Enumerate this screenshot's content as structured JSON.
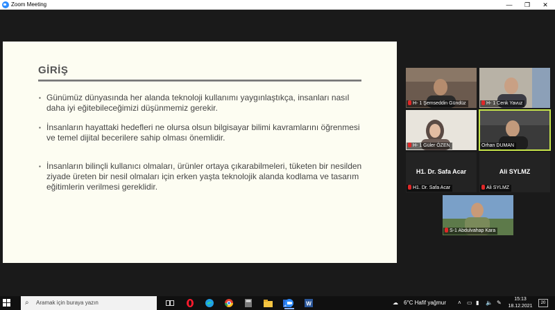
{
  "window": {
    "title": "Zoom Meeting",
    "controls": {
      "minimize": "—",
      "maximize": "❐",
      "close": "✕"
    }
  },
  "slide": {
    "title": "GİRİŞ",
    "bullets": [
      "Günümüz dünyasında her alanda teknoloji kullanımı yaygınlaştıkça, insanları nasıl daha iyi eğitebileceğimizi düşünmemiz gerekir.",
      "İnsanların hayattaki hedefleri ne olursa olsun bilgisayar bilimi kavramlarını öğrenmesi ve temel dijital becerilere sahip olması önemlidir.",
      "İnsanların bilinçli kullanıcı olmaları, ürünler ortaya çıkarabilmeleri, tüketen bir nesilden ziyade üreten bir nesil olmaları için erken yaşta teknolojik alanda kodlama ve tasarım eğitimlerin verilmesi gereklidir."
    ],
    "bullet_mark": "▪"
  },
  "participants": [
    {
      "name": "H- 1 Şemseddin Gündüz",
      "video": true,
      "muted": true
    },
    {
      "name": "H- 1 Cenk Yavuz",
      "video": true,
      "muted": true
    },
    {
      "name": "H- 1 Güler ÖZEN",
      "video": true,
      "muted": true
    },
    {
      "name": "Orhan DUMAN",
      "video": true,
      "muted": false,
      "active_speaker": true
    },
    {
      "name": "H1. Dr. Safa Acar",
      "display_name": "H1. Dr. Safa Acar",
      "video": false,
      "muted": true
    },
    {
      "name": "Ali SYLMZ",
      "display_name": "Ali SYLMZ",
      "video": false,
      "muted": true
    },
    {
      "name": "S-1 Abdulvahap Kara",
      "video": true,
      "muted": true
    }
  ],
  "taskbar": {
    "search_placeholder": "Aramak için buraya yazın",
    "weather": "6°C  Hafif yağmur",
    "time": "15:13",
    "date": "18.12.2021",
    "notification_count": "20",
    "apps": [
      "task-view",
      "opera",
      "edge",
      "chrome",
      "calculator",
      "file-explorer",
      "photos",
      "zoom",
      "word"
    ]
  },
  "colors": {
    "slide_bg": "#fdfdf2",
    "meeting_bg": "#1a1a1a",
    "active_speaker": "#c8e64a",
    "muted_mic": "#e02828"
  }
}
